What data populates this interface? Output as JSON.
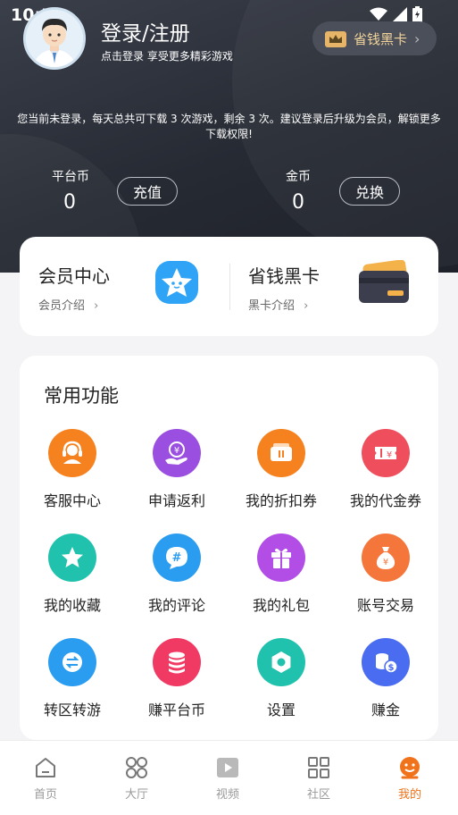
{
  "status_bar": {
    "time": "10:55"
  },
  "profile": {
    "title": "登录/注册",
    "subtitle": "点击登录 享受更多精彩游戏",
    "blackcard_label": "省钱黑卡"
  },
  "notice": "您当前未登录，每天总共可下载 3 次游戏，剩余 3 次。建议登录后升级为会员，解锁更多下载权限!",
  "balances": [
    {
      "label": "平台币",
      "value": "0",
      "button": "充值"
    },
    {
      "label": "金币",
      "value": "0",
      "button": "兑换"
    }
  ],
  "vip": [
    {
      "title": "会员中心",
      "link": "会员介绍"
    },
    {
      "title": "省钱黑卡",
      "link": "黑卡介绍"
    }
  ],
  "functions": {
    "title": "常用功能",
    "items": [
      {
        "label": "客服中心",
        "icon": "headset-icon",
        "color": "#f5821f"
      },
      {
        "label": "申请返利",
        "icon": "rebate-hand-icon",
        "color": "#9b4fe0"
      },
      {
        "label": "我的折扣券",
        "icon": "discount-ticket-icon",
        "color": "#f5821f"
      },
      {
        "label": "我的代金券",
        "icon": "voucher-icon",
        "color": "#ef4f5c"
      },
      {
        "label": "我的收藏",
        "icon": "star-icon",
        "color": "#21c2ad"
      },
      {
        "label": "我的评论",
        "icon": "comment-icon",
        "color": "#2b9df0"
      },
      {
        "label": "我的礼包",
        "icon": "gift-icon",
        "color": "#b24ee6"
      },
      {
        "label": "账号交易",
        "icon": "money-bag-icon",
        "color": "#f5763a"
      },
      {
        "label": "转区转游",
        "icon": "transfer-icon",
        "color": "#2b9df0"
      },
      {
        "label": "赚平台币",
        "icon": "coin-stack-icon",
        "color": "#f03a64"
      },
      {
        "label": "设置",
        "icon": "settings-icon",
        "color": "#21c2ad"
      },
      {
        "label": "赚金",
        "icon": "gold-coins-icon",
        "color": "#4a6cf0"
      }
    ]
  },
  "tabbar": {
    "items": [
      {
        "label": "首页",
        "icon": "home-icon"
      },
      {
        "label": "大厅",
        "icon": "grid-circles-icon"
      },
      {
        "label": "视频",
        "icon": "video-icon"
      },
      {
        "label": "社区",
        "icon": "community-grid-icon"
      },
      {
        "label": "我的",
        "icon": "mine-face-icon"
      }
    ],
    "active_color": "#f0731c"
  }
}
